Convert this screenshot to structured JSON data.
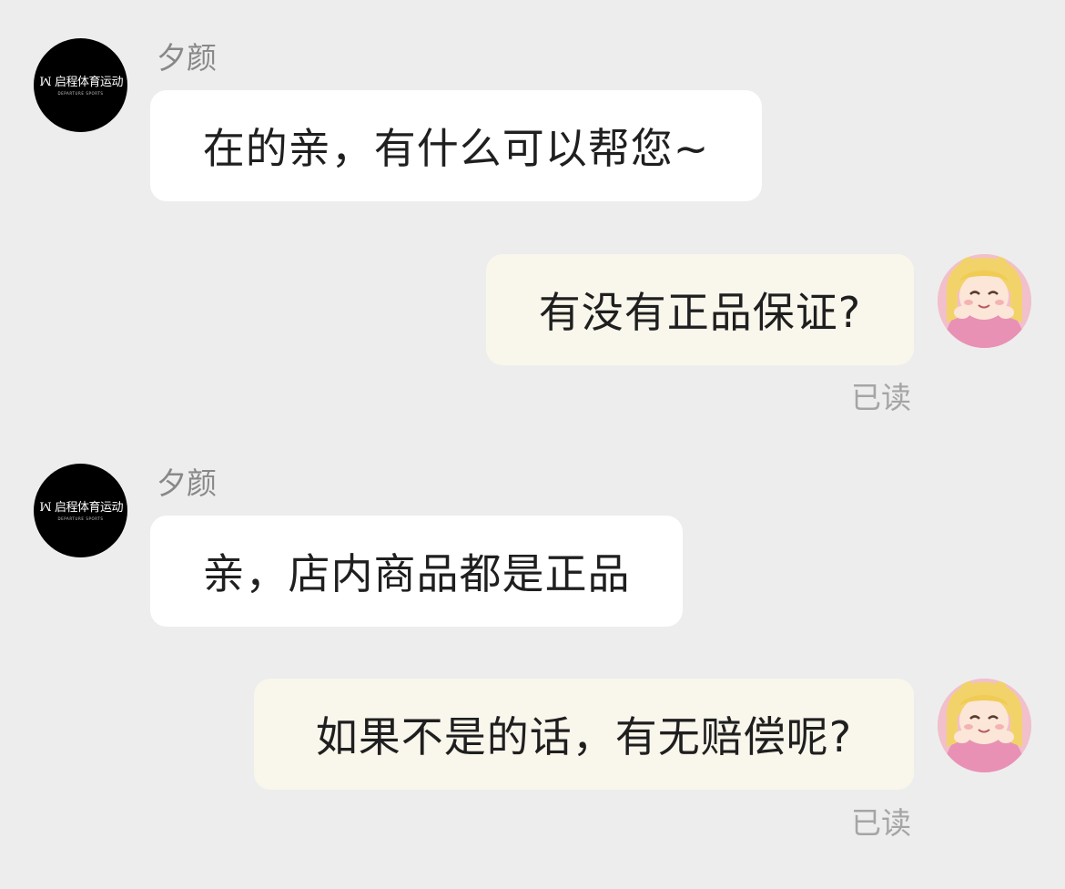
{
  "shop": {
    "name": "夕颜",
    "avatar_text": "启程体育运动",
    "avatar_subtext": "DEPARTURE SPORTS"
  },
  "messages": [
    {
      "from": "shop",
      "sender": "夕颜",
      "text": "在的亲，有什么可以帮您~"
    },
    {
      "from": "me",
      "text": "有没有正品保证?",
      "status": "已读"
    },
    {
      "from": "shop",
      "sender": "夕颜",
      "text": "亲，店内商品都是正品"
    },
    {
      "from": "me",
      "text": "如果不是的话，有无赔偿呢?",
      "status": "已读"
    }
  ],
  "colors": {
    "background": "#ededed",
    "incoming_bubble": "#ffffff",
    "outgoing_bubble": "#f9f6ec",
    "sender_name": "#888888",
    "read_status": "#a5a5a5"
  }
}
